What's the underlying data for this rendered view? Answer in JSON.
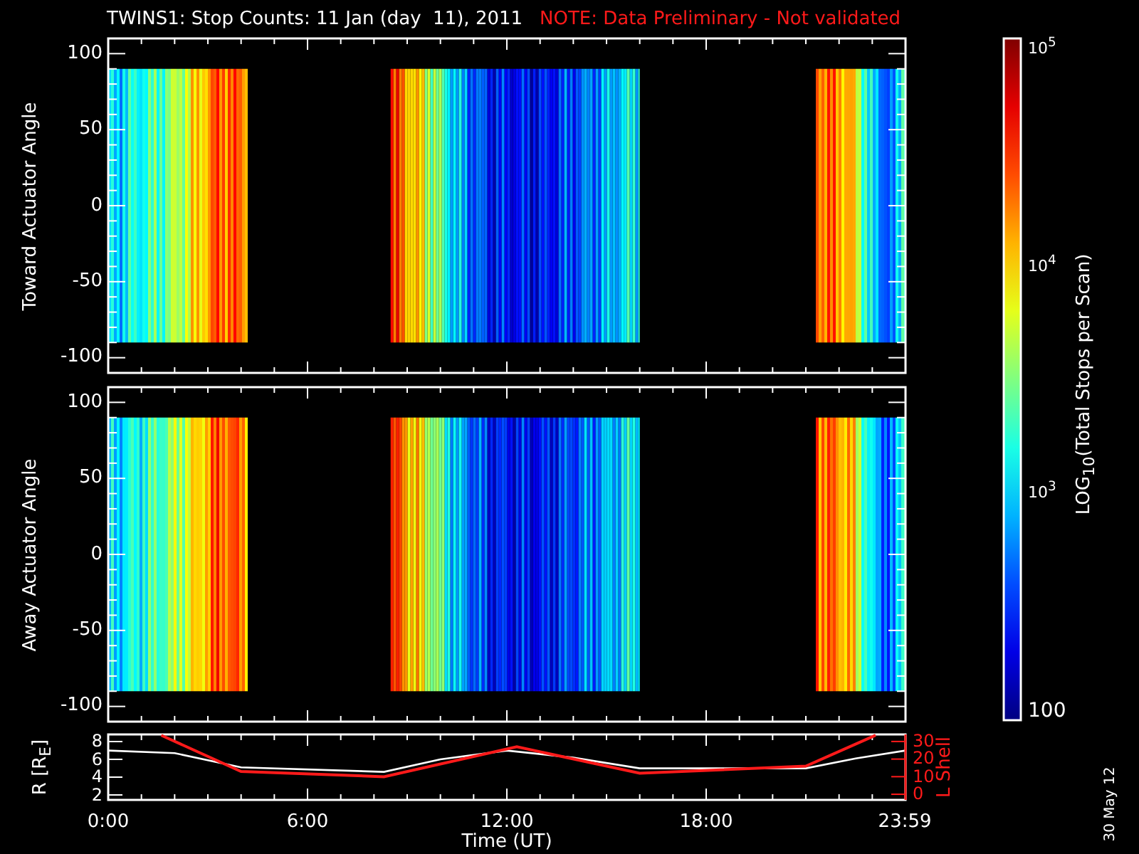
{
  "title": "TWINS1: Stop Counts: 11 Jan (day  11), 2011",
  "note": "NOTE: Data Preliminary - Not validated",
  "panels": [
    {
      "ylabel": "Toward Actuator Angle",
      "yticks": [
        "100",
        "50",
        "0",
        "-50",
        "-100"
      ]
    },
    {
      "ylabel": "Away Actuator Angle",
      "yticks": [
        "100",
        "50",
        "0",
        "-50",
        "-100"
      ]
    }
  ],
  "colorbar": {
    "title": "LOG$_{10}$(Total Stops per Scan)",
    "labels": [
      "10$^{5}$",
      "10$^{4}$",
      "10$^{3}$",
      "100"
    ]
  },
  "orbit": {
    "chart_data": {
      "type": "line",
      "xlabel": "Time (UT)",
      "ylabel": "R [R$_{E}$]",
      "x": [
        0,
        2,
        4,
        8.3,
        10,
        12,
        14,
        16,
        21,
        22.5,
        24
      ],
      "values": [
        7,
        6.7,
        5.1,
        4.6,
        6,
        7,
        6.2,
        5,
        5,
        6.1,
        7
      ],
      "xlim": [
        0,
        24
      ],
      "ylim": [
        1.44,
        8.8
      ],
      "xticks": [
        {
          "value": 0,
          "label": "0:00"
        },
        {
          "value": 6,
          "label": "6:00"
        },
        {
          "value": 12,
          "label": "12:00"
        },
        {
          "value": 18,
          "label": "18:00"
        },
        {
          "value": 23.98,
          "label": "23:59"
        }
      ],
      "yticks": [
        8,
        6,
        4,
        2
      ]
    }
  },
  "l_shell": {
    "chart_data": {
      "type": "line",
      "ylabel": "L Shell",
      "x": [
        1.6,
        4,
        8.3,
        12.3,
        16,
        21,
        23.1
      ],
      "values": [
        33.5,
        13,
        10,
        27,
        12,
        16,
        33.5
      ],
      "xlim": [
        0,
        24
      ],
      "ylim": [
        -3.2,
        34
      ],
      "yticks": [
        30,
        20,
        10,
        0
      ]
    }
  },
  "date_stamp": "30 May 12"
}
